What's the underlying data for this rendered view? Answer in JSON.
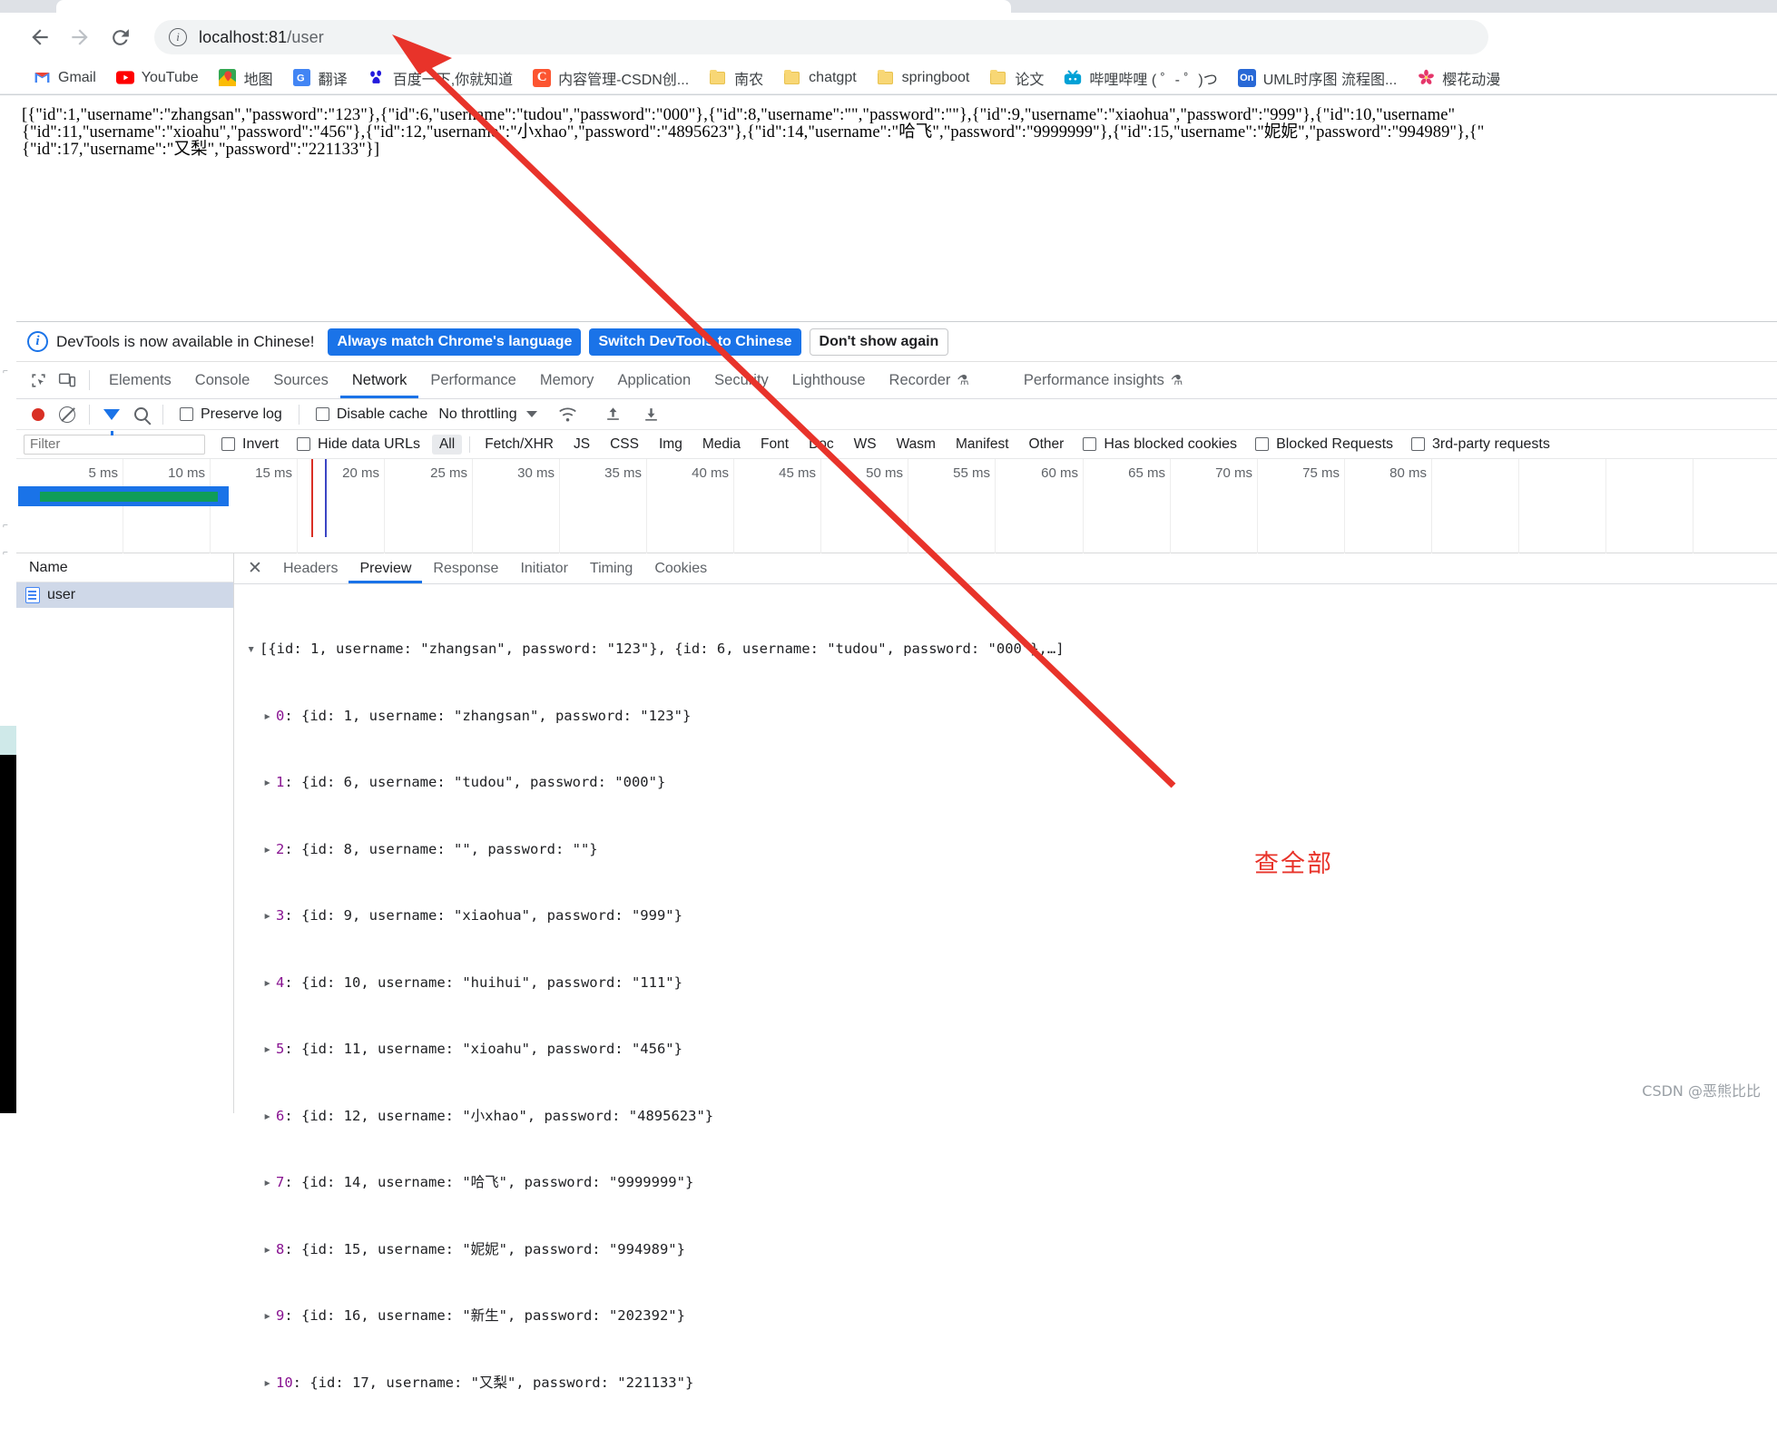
{
  "browser": {
    "nav": {
      "back": "back-arrow",
      "forward": "forward-arrow",
      "reload": "reload"
    },
    "omnibox": {
      "host": "localhost:81",
      "path": "/user",
      "full_url": "localhost:81/user"
    },
    "bookmarks": [
      {
        "label": "Gmail",
        "icon": "gmail-icon"
      },
      {
        "label": "YouTube",
        "icon": "youtube-icon"
      },
      {
        "label": "地图",
        "icon": "maps-icon"
      },
      {
        "label": "翻译",
        "icon": "translate-icon"
      },
      {
        "label": "百度一下,你就知道",
        "icon": "baidu-icon"
      },
      {
        "label": "内容管理-CSDN创...",
        "icon": "csdn-icon"
      },
      {
        "label": "南农",
        "icon": "folder-icon"
      },
      {
        "label": "chatgpt",
        "icon": "folder-icon"
      },
      {
        "label": "springboot",
        "icon": "folder-icon"
      },
      {
        "label": "论文",
        "icon": "folder-icon"
      },
      {
        "label": "哔哩哔哩 ( ゜- ゜)つ",
        "icon": "bilibili-icon"
      },
      {
        "label": "UML时序图 流程图...",
        "icon": "on-icon"
      },
      {
        "label": "樱花动漫",
        "icon": "sakura-icon"
      }
    ]
  },
  "page": {
    "json_response_lines": [
      "[{\"id\":1,\"username\":\"zhangsan\",\"password\":\"123\"},{\"id\":6,\"username\":\"tudou\",\"password\":\"000\"},{\"id\":8,\"username\":\"\",\"password\":\"\"},{\"id\":9,\"username\":\"xiaohua\",\"password\":\"999\"},{\"id\":10,\"username\"",
      "{\"id\":11,\"username\":\"xioahu\",\"password\":\"456\"},{\"id\":12,\"username\":\"小xhao\",\"password\":\"4895623\"},{\"id\":14,\"username\":\"哈飞\",\"password\":\"9999999\"},{\"id\":15,\"username\":\"妮妮\",\"password\":\"994989\"},{\"",
      "{\"id\":17,\"username\":\"又梨\",\"password\":\"221133\"}]"
    ]
  },
  "devtools": {
    "banner": {
      "message": "DevTools is now available in Chinese!",
      "always_match": "Always match Chrome's language",
      "switch": "Switch DevTools to Chinese",
      "dont_show": "Don't show again"
    },
    "panel_tabs": [
      {
        "label": "Elements",
        "selected": false
      },
      {
        "label": "Console",
        "selected": false
      },
      {
        "label": "Sources",
        "selected": false
      },
      {
        "label": "Network",
        "selected": true
      },
      {
        "label": "Performance",
        "selected": false
      },
      {
        "label": "Memory",
        "selected": false
      },
      {
        "label": "Application",
        "selected": false
      },
      {
        "label": "Security",
        "selected": false
      },
      {
        "label": "Lighthouse",
        "selected": false
      },
      {
        "label": "Recorder",
        "selected": false,
        "flask": "⚗"
      },
      {
        "label": "Performance insights",
        "selected": false,
        "flask": "⚗"
      }
    ],
    "toolbar": {
      "record_icon": "record-stop-icon",
      "clear_icon": "clear-icon",
      "filter_icon": "filter-funnel-icon",
      "search_icon": "search-icon",
      "preserve_log": "Preserve log",
      "disable_cache": "Disable cache",
      "throttling": "No throttling",
      "wifi_icon": "network-conditions-icon",
      "import_icon": "import-har-icon",
      "export_icon": "export-har-icon"
    },
    "filterbar": {
      "filter_placeholder": "Filter",
      "invert": "Invert",
      "hide_data_urls": "Hide data URLs",
      "types": [
        "All",
        "Fetch/XHR",
        "JS",
        "CSS",
        "Img",
        "Media",
        "Font",
        "Doc",
        "WS",
        "Wasm",
        "Manifest",
        "Other"
      ],
      "selected_type": "All",
      "has_blocked_cookies": "Has blocked cookies",
      "blocked_requests": "Blocked Requests",
      "third_party": "3rd-party requests"
    },
    "timeline": {
      "ticks": [
        "5 ms",
        "10 ms",
        "15 ms",
        "20 ms",
        "25 ms",
        "30 ms",
        "35 ms",
        "40 ms",
        "45 ms",
        "50 ms",
        "55 ms",
        "60 ms",
        "65 ms",
        "70 ms",
        "75 ms",
        "80 ms"
      ],
      "unit": "ms"
    },
    "request_list": {
      "header": "Name",
      "rows": [
        {
          "name": "user",
          "icon": "document-icon",
          "selected": true
        }
      ]
    },
    "detail_tabs": [
      {
        "label": "Headers",
        "selected": false
      },
      {
        "label": "Preview",
        "selected": true
      },
      {
        "label": "Response",
        "selected": false
      },
      {
        "label": "Initiator",
        "selected": false
      },
      {
        "label": "Timing",
        "selected": false
      },
      {
        "label": "Cookies",
        "selected": false
      }
    ],
    "preview_tree": {
      "root": "[{id: 1, username: \"zhangsan\", password: \"123\"}, {id: 6, username: \"tudou\", password: \"000\"},…]",
      "rows": [
        {
          "index": "0",
          "value": "{id: 1, username: \"zhangsan\", password: \"123\"}"
        },
        {
          "index": "1",
          "value": "{id: 6, username: \"tudou\", password: \"000\"}"
        },
        {
          "index": "2",
          "value": "{id: 8, username: \"\", password: \"\"}"
        },
        {
          "index": "3",
          "value": "{id: 9, username: \"xiaohua\", password: \"999\"}"
        },
        {
          "index": "4",
          "value": "{id: 10, username: \"huihui\", password: \"111\"}"
        },
        {
          "index": "5",
          "value": "{id: 11, username: \"xioahu\", password: \"456\"}"
        },
        {
          "index": "6",
          "value": "{id: 12, username: \"小xhao\", password: \"4895623\"}"
        },
        {
          "index": "7",
          "value": "{id: 14, username: \"哈飞\", password: \"9999999\"}"
        },
        {
          "index": "8",
          "value": "{id: 15, username: \"妮妮\", password: \"994989\"}"
        },
        {
          "index": "9",
          "value": "{id: 16, username: \"新生\", password: \"202392\"}"
        },
        {
          "index": "10",
          "value": "{id: 17, username: \"又梨\", password: \"221133\"}"
        }
      ]
    }
  },
  "annotation": {
    "text": "查全部",
    "color": "#e8332a",
    "arrow": "red-arrow-pointing-to-address-bar"
  },
  "watermark": "CSDN @恶熊比比",
  "colors": {
    "accent": "#1a73e8",
    "record": "#d93025",
    "annotation": "#e8332a",
    "selection": "#cfd8e8"
  }
}
